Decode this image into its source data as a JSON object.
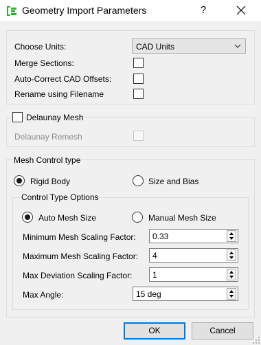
{
  "window": {
    "title": "Geometry Import Parameters",
    "help_label": "?",
    "app_icon": "app-logo-icon",
    "close_icon": "close-icon"
  },
  "import_settings": {
    "choose_units_label": "Choose Units:",
    "units_value": "CAD Units",
    "merge_sections_label": "Merge Sections:",
    "merge_sections_checked": false,
    "auto_correct_label": "Auto-Correct CAD Offsets:",
    "auto_correct_checked": false,
    "rename_label": "Rename using Filename",
    "rename_checked": false
  },
  "delaunay": {
    "mesh_label": "Delaunay Mesh",
    "mesh_checked": false,
    "remesh_label": "Delaunay Remesh",
    "remesh_checked": false
  },
  "mesh_control": {
    "group_title": "Mesh Control type",
    "rigid_body_label": "Rigid Body",
    "size_bias_label": "Size and Bias",
    "selected": "Rigid Body",
    "options": {
      "group_title": "Control Type Options",
      "auto_mesh_label": "Auto Mesh Size",
      "manual_mesh_label": "Manual Mesh Size",
      "selected": "Auto Mesh Size",
      "min_factor_label": "Minimum Mesh Scaling Factor:",
      "min_factor_value": "0.33",
      "max_factor_label": "Maximum Mesh Scaling Factor:",
      "max_factor_value": "4",
      "max_dev_label": "Max Deviation Scaling Factor:",
      "max_dev_value": "1",
      "max_angle_label": "Max Angle:",
      "max_angle_value": "15 deg"
    }
  },
  "buttons": {
    "ok_label": "OK",
    "cancel_label": "Cancel"
  },
  "colors": {
    "accent": "#0078d7",
    "icon_green": "#3aa845"
  }
}
